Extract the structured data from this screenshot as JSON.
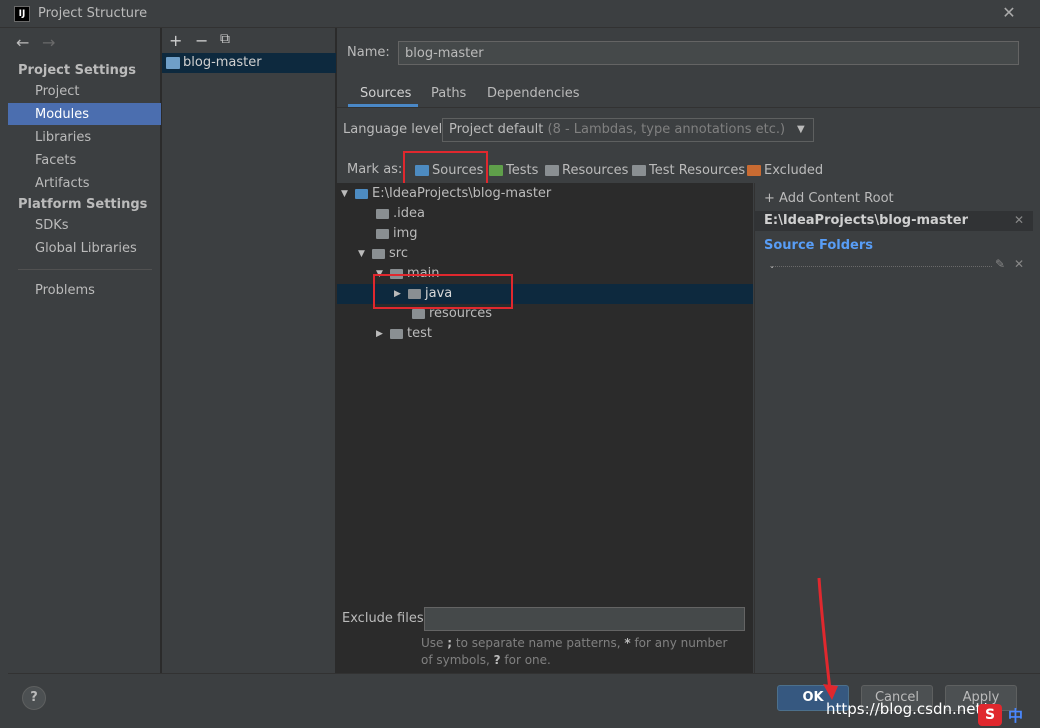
{
  "window": {
    "title": "Project Structure",
    "logo": "IJ",
    "close": "✕"
  },
  "sidebar": {
    "back": "←",
    "forward": "→",
    "project_settings": "Project Settings",
    "items_ps": [
      "Project",
      "Modules",
      "Libraries",
      "Facets",
      "Artifacts"
    ],
    "platform_settings": "Platform Settings",
    "items_pl": [
      "SDKs",
      "Global Libraries"
    ],
    "problems": "Problems",
    "selected": "Modules"
  },
  "modules": {
    "add": "+",
    "remove": "−",
    "copy": "⧉",
    "items": [
      "blog-master"
    ]
  },
  "name": {
    "label": "Name:",
    "value": "blog-master"
  },
  "tabs": [
    "Sources",
    "Paths",
    "Dependencies"
  ],
  "active_tab": "Sources",
  "language": {
    "label": "Language level:",
    "value": "Project default",
    "hint": "(8 - Lambdas, type annotations etc.)"
  },
  "mark_as": {
    "label": "Mark as:",
    "items": [
      {
        "label": "Sources",
        "color": "#4d8bc1"
      },
      {
        "label": "Tests",
        "color": "#5f9f4a"
      },
      {
        "label": "Resources",
        "color": "#8a8f92"
      },
      {
        "label": "Test Resources",
        "color": "#8a8f92"
      },
      {
        "label": "Excluded",
        "color": "#c96b32"
      }
    ]
  },
  "tree": [
    {
      "label": "E:\\IdeaProjects\\blog-master",
      "expanded": true
    },
    {
      "label": ".idea"
    },
    {
      "label": "img"
    },
    {
      "label": "src",
      "expanded": true
    },
    {
      "label": "main",
      "expanded": true
    },
    {
      "label": "java",
      "selected": true
    },
    {
      "label": "resources"
    },
    {
      "label": "test"
    }
  ],
  "exclude": {
    "label": "Exclude files:",
    "value": ""
  },
  "hint": {
    "p1": "Use ",
    "semicolon": ";",
    "p2": " to separate name patterns, ",
    "star": "*",
    "p3": " for any number of symbols, ",
    "q": "?",
    "p4": " for one."
  },
  "content_root": {
    "add": "Add Content Root",
    "path": "E:\\IdeaProjects\\blog-master",
    "source_folders": "Source Folders",
    "entry": "."
  },
  "footer": {
    "help": "?",
    "ok": "OK",
    "cancel": "Cancel",
    "apply": "Apply"
  },
  "watermark": {
    "text": "https://blog.csdn.net/",
    "s_logo": "S",
    "zh": "中"
  }
}
